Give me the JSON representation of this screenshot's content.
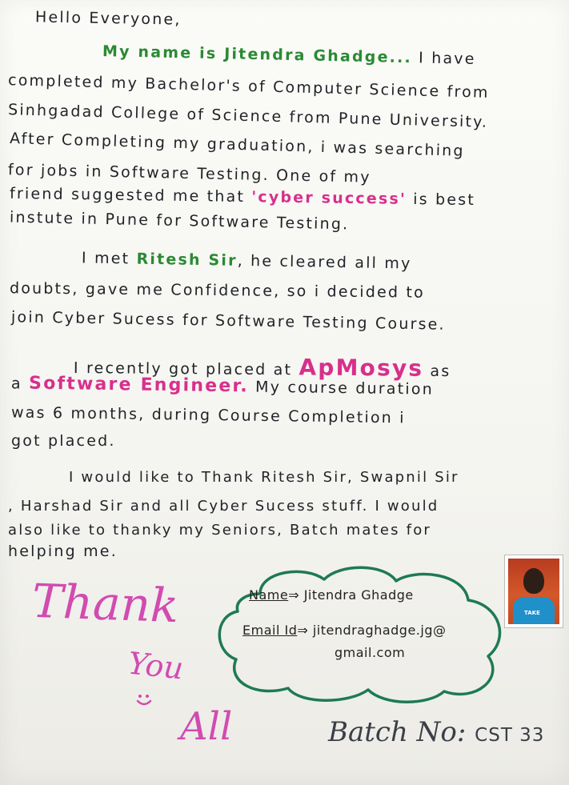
{
  "letter": {
    "greeting": "Hello Everyone,",
    "p1": [
      {
        "parts": [
          "My name is Jitendra Ghadge...",
          " I have"
        ]
      },
      {
        "text": "completed my Bachelor's of Computer Science from"
      },
      {
        "text": "Sinhgadad College of Science from Pune University."
      },
      {
        "text": "After Completing my graduation, i was searching"
      },
      {
        "text": "for jobs in Software Testing. One of my"
      },
      {
        "parts": [
          "friend suggested me that ",
          "'cyber success'",
          " is best"
        ]
      },
      {
        "text": "instute in Pune for Software Testing."
      }
    ],
    "p2": [
      {
        "parts": [
          "I met ",
          "Ritesh Sir",
          ", he cleared all my"
        ]
      },
      {
        "text": "doubts, gave me Confidence, so i decided to"
      },
      {
        "text": "join Cyber Sucess for Software Testing Course."
      }
    ],
    "p3": [
      {
        "parts": [
          "I recently got placed at ",
          "ApMosys",
          " as"
        ]
      },
      {
        "parts": [
          "a ",
          "Software Engineer.",
          " My course duration"
        ]
      },
      {
        "text": "was 6 months, during Course Completion i"
      },
      {
        "text": "got placed."
      }
    ],
    "p4": [
      {
        "text": "I would like to Thank Ritesh Sir, Swapnil Sir"
      },
      {
        "text": ", Harshad Sir and all Cyber Sucess stuff. I would"
      },
      {
        "text": "also like to thanky my Seniors, Batch mates for"
      },
      {
        "text": "helping me."
      }
    ]
  },
  "signature": {
    "thank": "Thank",
    "you": "You",
    "all": "All"
  },
  "contact": {
    "name_label": "Name",
    "name_value": "Jitendra Ghadge",
    "email_label": "Email Id",
    "email_value": "jitendraghadge.jg@",
    "email_value2": "gmail.com",
    "arrow": "⇒"
  },
  "photo": {
    "stamp": "TAKE"
  },
  "batch": {
    "label": "Batch No:",
    "code": "CST 33"
  },
  "colors": {
    "ink": "#1f2327",
    "green": "#2a8a33",
    "pink": "#d82f8c",
    "magenta_marker": "#d14bb0",
    "cloud_outline": "#1e7a52"
  }
}
